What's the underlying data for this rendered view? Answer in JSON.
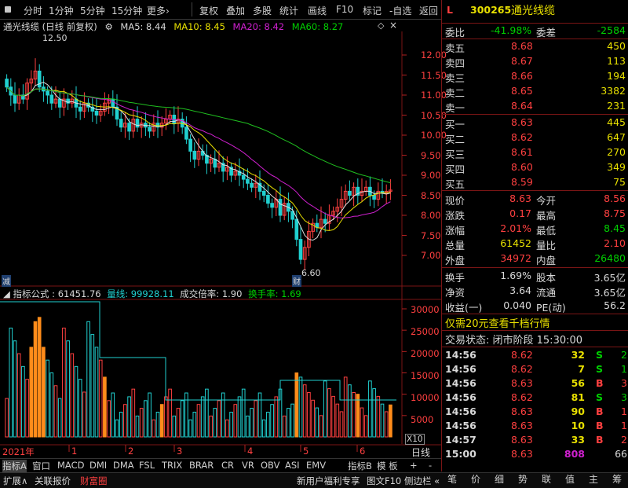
{
  "toolbar": {
    "period_tabs": [
      "分时",
      "1分钟",
      "5分钟",
      "15分钟",
      "更多›"
    ],
    "actions": [
      "复权",
      "叠加",
      "多股",
      "统计",
      "画线",
      "F10",
      "标记",
      "-自选",
      "返回"
    ]
  },
  "chart_header": {
    "title": "通光线缆 (日线 前复权)",
    "ma5": "MA5: 8.44",
    "ma10": "MA10: 8.45",
    "ma20": "MA20: 8.42",
    "ma60": "MA60: 8.27"
  },
  "price_axis": [
    "12.00",
    "11.50",
    "11.00",
    "10.50",
    "10.00",
    "9.50",
    "9.00",
    "8.50",
    "8.00",
    "7.50",
    "7.00"
  ],
  "price_marks": {
    "high_label": "12.50",
    "low_label": "6.60",
    "cai_tag": "财",
    "jian_tag": "减"
  },
  "volume_header": {
    "formula": "指标公式 : 61451.76",
    "liangxian": "量线: 99928.11",
    "chengjiao": "成交倍率: 1.90",
    "huanshou": "换手率: 1.69"
  },
  "volume_axis": [
    "30000",
    "25000",
    "20000",
    "15000",
    "10000",
    "5000"
  ],
  "volume_unit": "X10",
  "time_axis": {
    "labels": [
      "2021年",
      "1",
      "2",
      "3",
      "4",
      "5",
      "6"
    ],
    "period": "日线"
  },
  "indicator_tabs": [
    "指标A",
    "窗口",
    "MACD",
    "DMI",
    "DMA",
    "FSL",
    "TRIX",
    "BRAR",
    "CR",
    "VR",
    "OBV",
    "ASI",
    "EMV"
  ],
  "indicator_extra": [
    "指标B",
    "模 板",
    "+",
    "-"
  ],
  "status_bar": {
    "left": [
      "扩展∧",
      "关联报价",
      "财富圈"
    ],
    "middle": "新用户福利专享",
    "f10": "图文F10",
    "side": "侧边栏 «",
    "right_tabs": [
      "笔",
      "价",
      "细",
      "势",
      "联",
      "值",
      "主",
      "筹"
    ]
  },
  "quote": {
    "flag": "L",
    "code": "300265",
    "name": "通光线缆",
    "weibi_label": "委比",
    "weibi": "-41.98%",
    "weicha_label": "委差",
    "weicha": "-2584",
    "sells": [
      {
        "label": "卖五",
        "price": "8.68",
        "vol": "450"
      },
      {
        "label": "卖四",
        "price": "8.67",
        "vol": "113"
      },
      {
        "label": "卖三",
        "price": "8.66",
        "vol": "194"
      },
      {
        "label": "卖二",
        "price": "8.65",
        "vol": "3382"
      },
      {
        "label": "卖一",
        "price": "8.64",
        "vol": "231"
      }
    ],
    "buys": [
      {
        "label": "买一",
        "price": "8.63",
        "vol": "445"
      },
      {
        "label": "买二",
        "price": "8.62",
        "vol": "647"
      },
      {
        "label": "买三",
        "price": "8.61",
        "vol": "270"
      },
      {
        "label": "买四",
        "price": "8.60",
        "vol": "349"
      },
      {
        "label": "买五",
        "price": "8.59",
        "vol": "75"
      }
    ],
    "stats": [
      {
        "l1": "现价",
        "v1": "8.63",
        "c1": "red",
        "l2": "今开",
        "v2": "8.56",
        "c2": "red"
      },
      {
        "l1": "涨跌",
        "v1": "0.17",
        "c1": "red",
        "l2": "最高",
        "v2": "8.75",
        "c2": "red"
      },
      {
        "l1": "涨幅",
        "v1": "2.01%",
        "c1": "red",
        "l2": "最低",
        "v2": "8.45",
        "c2": "green"
      },
      {
        "l1": "总量",
        "v1": "61452",
        "c1": "yellow",
        "l2": "量比",
        "v2": "2.10",
        "c2": "red"
      },
      {
        "l1": "外盘",
        "v1": "34972",
        "c1": "red",
        "l2": "内盘",
        "v2": "26480",
        "c2": "green"
      }
    ],
    "fin": [
      {
        "l1": "换手",
        "v1": "1.69%",
        "l2": "股本",
        "v2": "3.65亿"
      },
      {
        "l1": "净资",
        "v1": "3.64",
        "l2": "流通",
        "v2": "3.65亿"
      },
      {
        "l1": "收益(一)",
        "v1": "0.040",
        "l2": "PE(动)",
        "v2": "56.2"
      }
    ],
    "promo": "仅需20元查看千档行情",
    "trade_status": "交易状态: 闭市阶段 15:30:00",
    "ticks": [
      {
        "t": "14:56",
        "p": "8.62",
        "v": "32",
        "s": "S",
        "n": "2"
      },
      {
        "t": "14:56",
        "p": "8.62",
        "v": "7",
        "s": "S",
        "n": "1"
      },
      {
        "t": "14:56",
        "p": "8.63",
        "v": "56",
        "s": "B",
        "n": "3"
      },
      {
        "t": "14:56",
        "p": "8.62",
        "v": "81",
        "s": "S",
        "n": "3"
      },
      {
        "t": "14:56",
        "p": "8.63",
        "v": "90",
        "s": "B",
        "n": "1"
      },
      {
        "t": "14:56",
        "p": "8.63",
        "v": "10",
        "s": "B",
        "n": "1"
      },
      {
        "t": "14:57",
        "p": "8.63",
        "v": "33",
        "s": "B",
        "n": "2"
      },
      {
        "t": "15:00",
        "p": "8.63",
        "v": "808",
        "s": "",
        "n": "66"
      }
    ]
  },
  "colors": {
    "up": "#ff4040",
    "down": "#20d0d0",
    "ma5": "#e0e0e0",
    "ma10": "#e8e000",
    "ma20": "#d020d0",
    "ma60": "#20c020",
    "volume_line": "#20d0d0"
  }
}
